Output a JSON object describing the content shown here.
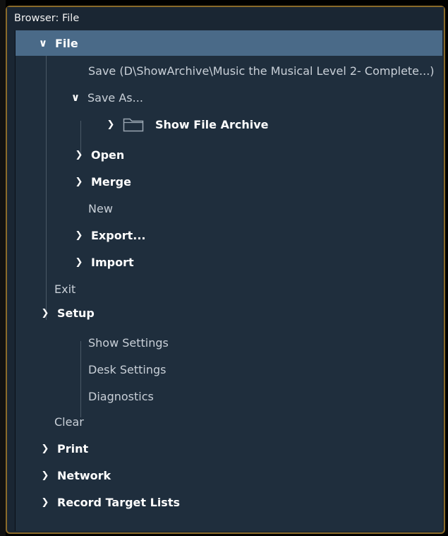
{
  "window": {
    "title": "Browser: File"
  },
  "tree": {
    "file": {
      "label": "File",
      "expanded": true,
      "selected": true
    },
    "save": {
      "label": "Save (D\\ShowArchive\\Music the Musical Level 2- Complete...)"
    },
    "save_as": {
      "label": "Save  As...",
      "expanded": true
    },
    "show_file_archive": {
      "label": "Show File Archive",
      "expanded": false
    },
    "open": {
      "label": "Open"
    },
    "merge": {
      "label": "Merge"
    },
    "new": {
      "label": "New"
    },
    "export": {
      "label": "Export..."
    },
    "import": {
      "label": "Import"
    },
    "exit": {
      "label": "Exit"
    },
    "setup": {
      "label": "Setup",
      "expanded": true
    },
    "show_settings": {
      "label": "Show Settings"
    },
    "desk_settings": {
      "label": "Desk Settings"
    },
    "diagnostics": {
      "label": "Diagnostics"
    },
    "clear": {
      "label": "Clear"
    },
    "print": {
      "label": "Print"
    },
    "network": {
      "label": "Network"
    },
    "record_target_lists": {
      "label": "Record Target Lists"
    }
  },
  "colors": {
    "background": "#1f2e3d",
    "selected": "#4a6a88",
    "frame_border": "#8a6a2a",
    "text": "#c9d0d8",
    "text_bold": "#ffffff"
  }
}
